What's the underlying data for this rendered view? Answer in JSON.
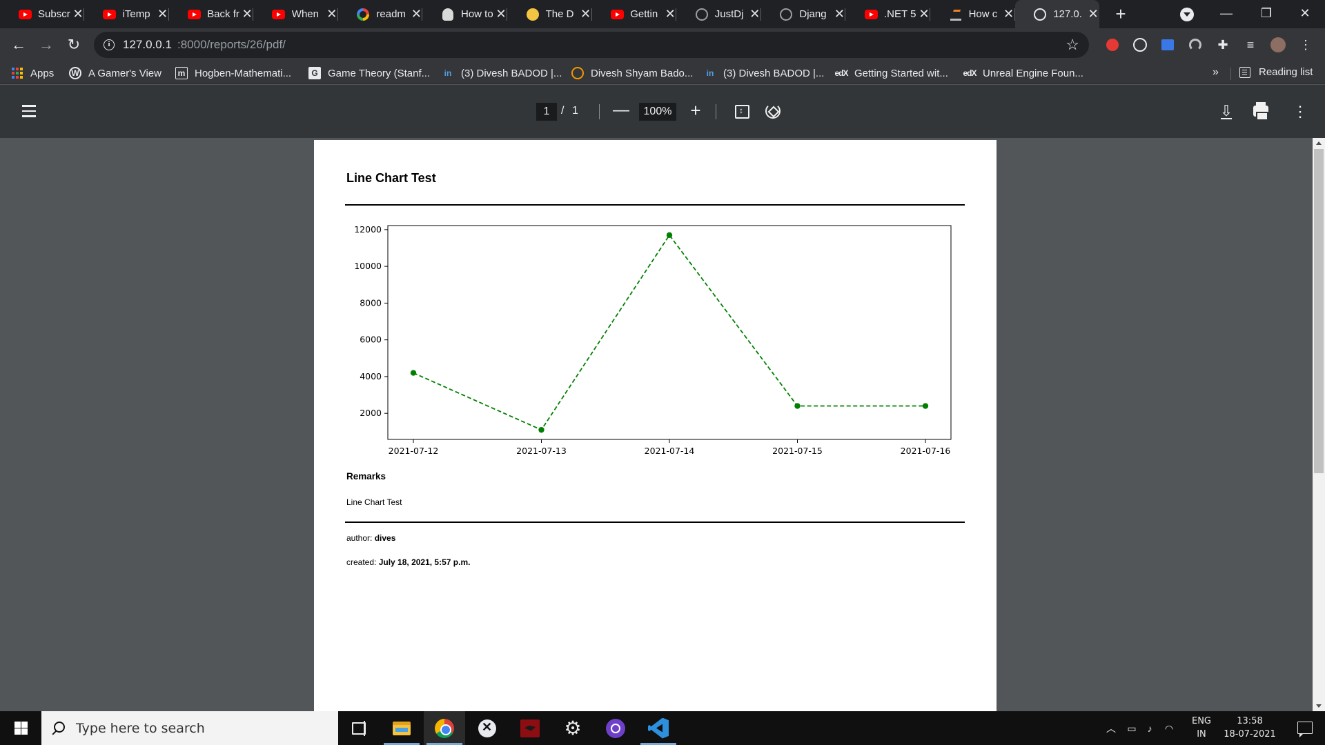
{
  "browser": {
    "tabs": [
      {
        "label": "Subscr",
        "favicon": "youtube-icon"
      },
      {
        "label": "iTemp",
        "favicon": "youtube-icon"
      },
      {
        "label": "Back fr",
        "favicon": "youtube-icon"
      },
      {
        "label": "When",
        "favicon": "youtube-icon"
      },
      {
        "label": "readm",
        "favicon": "google-icon"
      },
      {
        "label": "How to",
        "favicon": "owl-icon"
      },
      {
        "label": "The D",
        "favicon": "emoji-icon"
      },
      {
        "label": "Gettin",
        "favicon": "youtube-icon"
      },
      {
        "label": "JustDj",
        "favicon": "github-icon"
      },
      {
        "label": "Djang",
        "favicon": "github-icon"
      },
      {
        "label": ".NET 5",
        "favicon": "youtube-icon"
      },
      {
        "label": "How c",
        "favicon": "stackoverflow-icon"
      },
      {
        "label": "127.0.",
        "favicon": "globe-icon",
        "active": true
      }
    ],
    "new_tab_symbol": "+",
    "window_controls": {
      "minimize": "—",
      "maximize": "❐",
      "close": "✕"
    },
    "url": {
      "host": "127.0.0.1",
      "path": ":8000/reports/26/pdf/"
    },
    "nav": {
      "back": "←",
      "forward": "→",
      "reload": "↻"
    }
  },
  "bookmarks": {
    "items": [
      {
        "label": "Apps",
        "icon": "apps-grid-icon"
      },
      {
        "label": "A Gamer's View",
        "icon": "wordpress-icon",
        "glyph": "W"
      },
      {
        "label": "Hogben-Mathemati...",
        "icon": "column-icon",
        "glyph": "m"
      },
      {
        "label": "Game Theory (Stanf...",
        "icon": "page-icon",
        "glyph": "G"
      },
      {
        "label": "(3) Divesh BADOD |...",
        "icon": "linkedin-icon",
        "glyph": "in"
      },
      {
        "label": "Divesh Shyam Bado...",
        "icon": "profile-icon",
        "glyph": ""
      },
      {
        "label": "(3) Divesh BADOD |...",
        "icon": "linkedin-icon",
        "glyph": "in"
      },
      {
        "label": "Getting Started wit...",
        "icon": "edx-icon",
        "glyph": "edX"
      },
      {
        "label": "Unreal Engine Foun...",
        "icon": "edx-icon",
        "glyph": "edX"
      }
    ],
    "overflow": "»",
    "reading_list": "Reading list"
  },
  "pdf_viewer": {
    "current_page": "1",
    "slash": "/",
    "total_pages": "1",
    "zoom": "100%",
    "zoom_out": "—",
    "zoom_in": "+",
    "more": "⋮"
  },
  "document": {
    "title": "Line Chart Test",
    "remarks_heading": "Remarks",
    "remarks_text": "Line Chart Test",
    "author_label": "author:",
    "author_value": "dives",
    "created_label": "created:",
    "created_value": "July 18, 2021, 5:57 p.m."
  },
  "chart_data": {
    "type": "line",
    "title": "",
    "xlabel": "",
    "ylabel": "",
    "categories": [
      "2021-07-12",
      "2021-07-13",
      "2021-07-14",
      "2021-07-15",
      "2021-07-16"
    ],
    "series": [
      {
        "values": [
          4200,
          1100,
          11700,
          2400,
          2400
        ],
        "color": "#008000",
        "line_style": "dashed",
        "marker": "circle"
      }
    ],
    "yticks": [
      2000,
      4000,
      6000,
      8000,
      10000,
      12000
    ],
    "ylim": [
      580,
      12220
    ],
    "grid": false,
    "legend": "none"
  },
  "taskbar": {
    "search_placeholder": "Type here to search",
    "lang_line1": "ENG",
    "lang_line2": "IN",
    "time": "13:58",
    "date": "18-07-2021"
  }
}
